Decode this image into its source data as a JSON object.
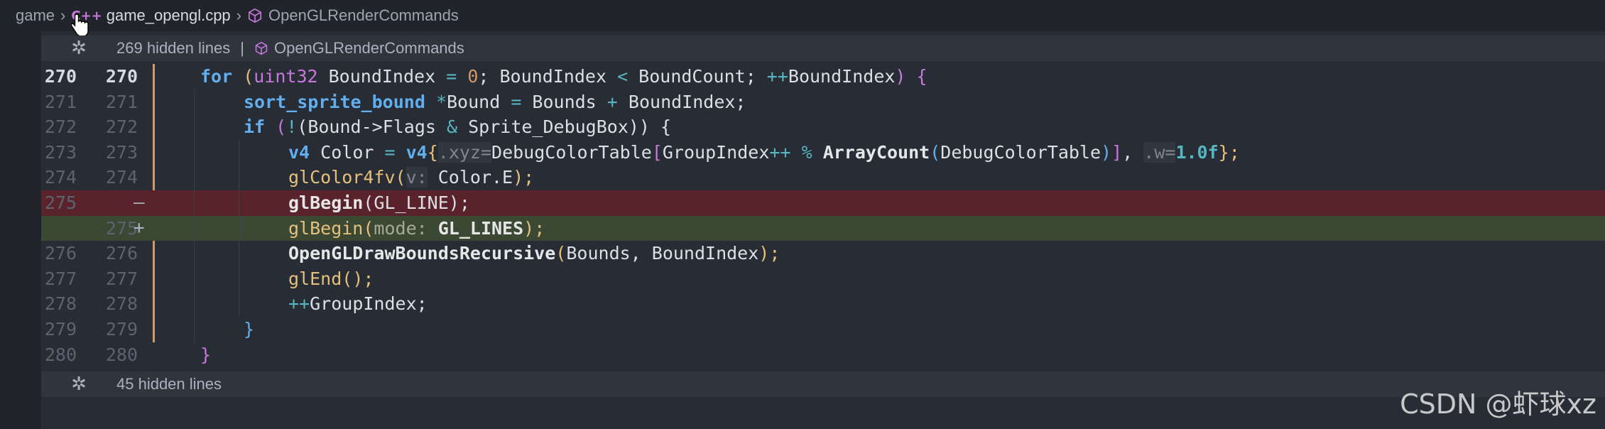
{
  "breadcrumb": {
    "folder": "game",
    "file": "game_opengl.cpp",
    "symbol": "OpenGLRenderCommands",
    "file_icon": "cpp-file-icon",
    "symbol_icon": "cube-icon"
  },
  "hidden_top": {
    "text": "269 hidden lines",
    "separator": "|",
    "symbol": "OpenGLRenderCommands"
  },
  "hidden_bottom": {
    "text": "45 hidden lines"
  },
  "lines": [
    {
      "old": "270",
      "new": "270",
      "type": "context"
    },
    {
      "old": "271",
      "new": "271",
      "type": "context"
    },
    {
      "old": "272",
      "new": "272",
      "type": "context"
    },
    {
      "old": "273",
      "new": "273",
      "type": "context"
    },
    {
      "old": "274",
      "new": "274",
      "type": "context"
    },
    {
      "old": "275",
      "new": "",
      "marker": "—",
      "type": "removed"
    },
    {
      "old": "",
      "new": "275",
      "marker": "+",
      "type": "added"
    },
    {
      "old": "276",
      "new": "276",
      "type": "context"
    },
    {
      "old": "277",
      "new": "277",
      "type": "context"
    },
    {
      "old": "278",
      "new": "278",
      "type": "context"
    },
    {
      "old": "279",
      "new": "279",
      "type": "context"
    },
    {
      "old": "280",
      "new": "280",
      "type": "context"
    }
  ],
  "code": {
    "l270": {
      "t1": "for",
      "t2": " (",
      "t3": "uint32",
      "t4": " BoundIndex ",
      "t5": "=",
      "t6": " ",
      "t7": "0",
      "t8": "; BoundIndex ",
      "t9": "<",
      "t10": " BoundCount; ",
      "t11": "++",
      "t12": "BoundIndex",
      "t13": ") {"
    },
    "l271": {
      "t1": "sort_sprite_bound",
      "t2": " ",
      "t3": "*",
      "t4": "Bound ",
      "t5": "=",
      "t6": " Bounds ",
      "t7": "+",
      "t8": " BoundIndex;"
    },
    "l272": {
      "t1": "if",
      "t2": " (",
      "t3": "!",
      "t4": "(Bound->Flags ",
      "t5": "&",
      "t6": " Sprite_DebugBox)) {"
    },
    "l273": {
      "t1": "v4",
      "t2": " Color ",
      "t3": "=",
      "t4": " ",
      "t5": "v4",
      "t6": "{",
      "t7": ".xyz=",
      "t8": "DebugColorTable",
      "t9": "[",
      "t10": "GroupIndex",
      "t11": "++",
      "t12": " ",
      "t13": "%",
      "t14": " ",
      "t15": "ArrayCount",
      "t16": "(",
      "t17": "DebugColorTable",
      "t18": ")",
      "t19": "]",
      "t20": ", ",
      "t21": ".w=",
      "t22": "1.0f",
      "t23": "};"
    },
    "l274": {
      "t1": "glColor4fv",
      "t2": "(",
      "t3": "v:",
      "t4": " Color.E",
      "t5": ");"
    },
    "l275a": {
      "t1": "glBegin",
      "t2": "(GL_LINE);"
    },
    "l275b": {
      "t1": "glBegin",
      "t2": "(",
      "t3": "mode:",
      "t4": " ",
      "t5": "GL_LINES",
      "t6": ");"
    },
    "l276": {
      "t1": "OpenGLDrawBoundsRecursive",
      "t2": "(",
      "t3": "Bounds, BoundIndex",
      "t4": ");"
    },
    "l277": {
      "t1": "glEnd",
      "t2": "();"
    },
    "l278": {
      "t1": "++",
      "t2": "GroupIndex;"
    },
    "l279": {
      "t1": "}"
    },
    "l280": {
      "t1": "}"
    }
  },
  "watermark": "CSDN @虾球xz"
}
